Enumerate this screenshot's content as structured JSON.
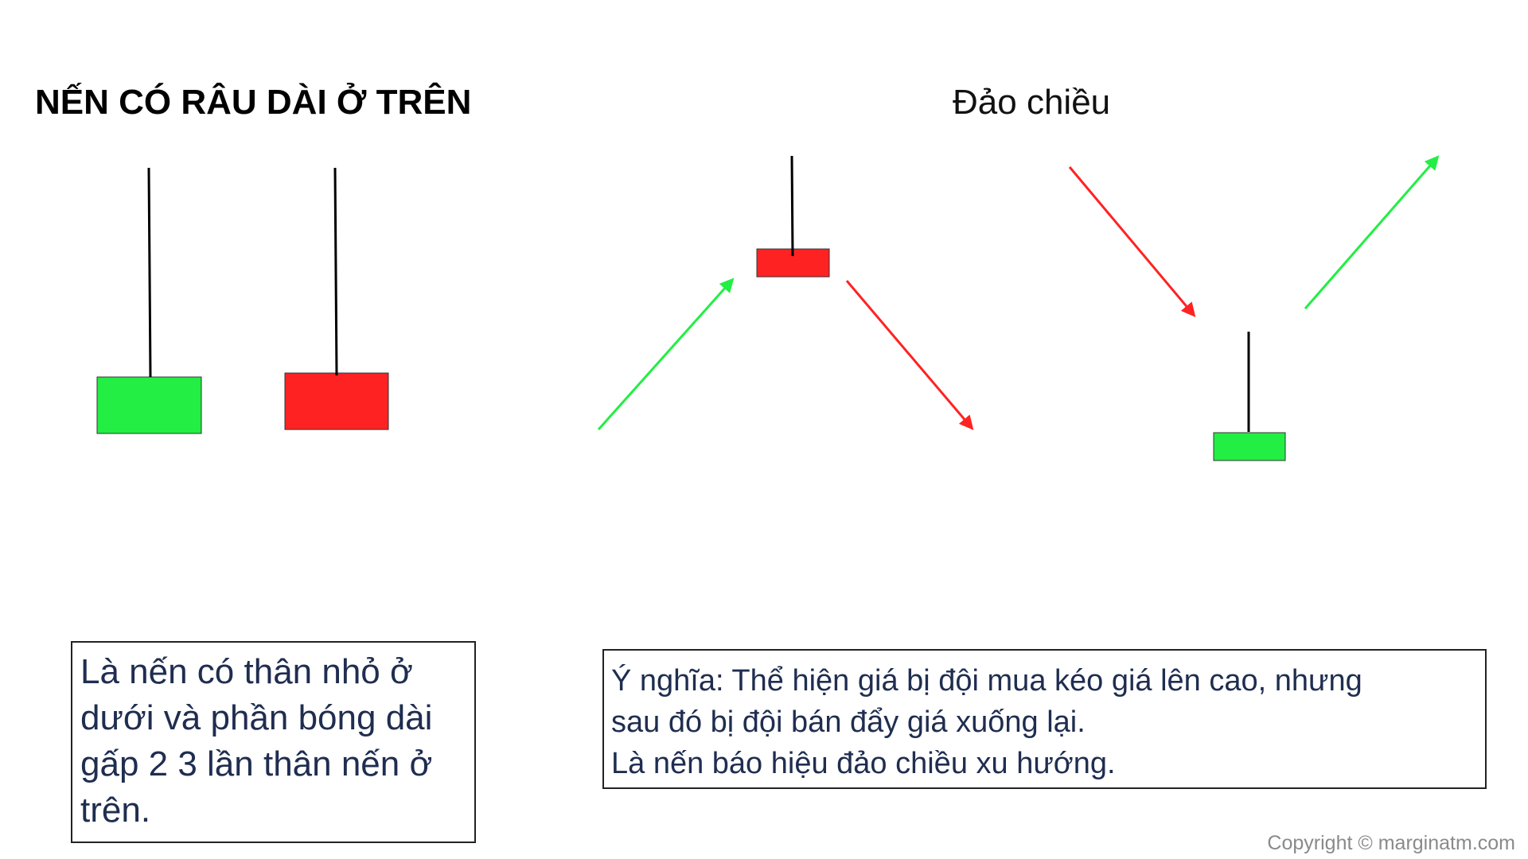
{
  "title_left": "NẾN CÓ RÂU DÀI Ở TRÊN",
  "title_right": "Đảo chiều",
  "definition_lines": [
    "Là nến có thân nhỏ ở",
    "dưới và phần bóng dài",
    "gấp 2 3 lần thân nến ở",
    "trên."
  ],
  "meaning_lines": [
    "Ý nghĩa: Thể hiện giá bị đội mua kéo giá lên cao, nhưng",
    "sau đó bị đội bán đẩy giá xuống lại.",
    "Là nến báo hiệu đảo chiều xu hướng."
  ],
  "copyright": "Copyright © marginatm.com",
  "colors": {
    "bullish": "#22ee44",
    "bearish": "#ff2222",
    "wick": "#000000",
    "text_dark": "#1f2d50"
  },
  "candles": [
    {
      "name": "example-green-candle",
      "color": "bullish"
    },
    {
      "name": "example-red-candle",
      "color": "bearish"
    },
    {
      "name": "top-reversal-red-candle",
      "color": "bearish"
    },
    {
      "name": "bottom-reversal-green-candle",
      "color": "bullish"
    }
  ],
  "arrows": [
    {
      "name": "uptrend-arrow-before-top",
      "color": "bullish",
      "direction": "up"
    },
    {
      "name": "downtrend-arrow-after-top",
      "color": "bearish",
      "direction": "down"
    },
    {
      "name": "downtrend-arrow-before-bottom",
      "color": "bearish",
      "direction": "down"
    },
    {
      "name": "uptrend-arrow-after-bottom",
      "color": "bullish",
      "direction": "up"
    }
  ]
}
